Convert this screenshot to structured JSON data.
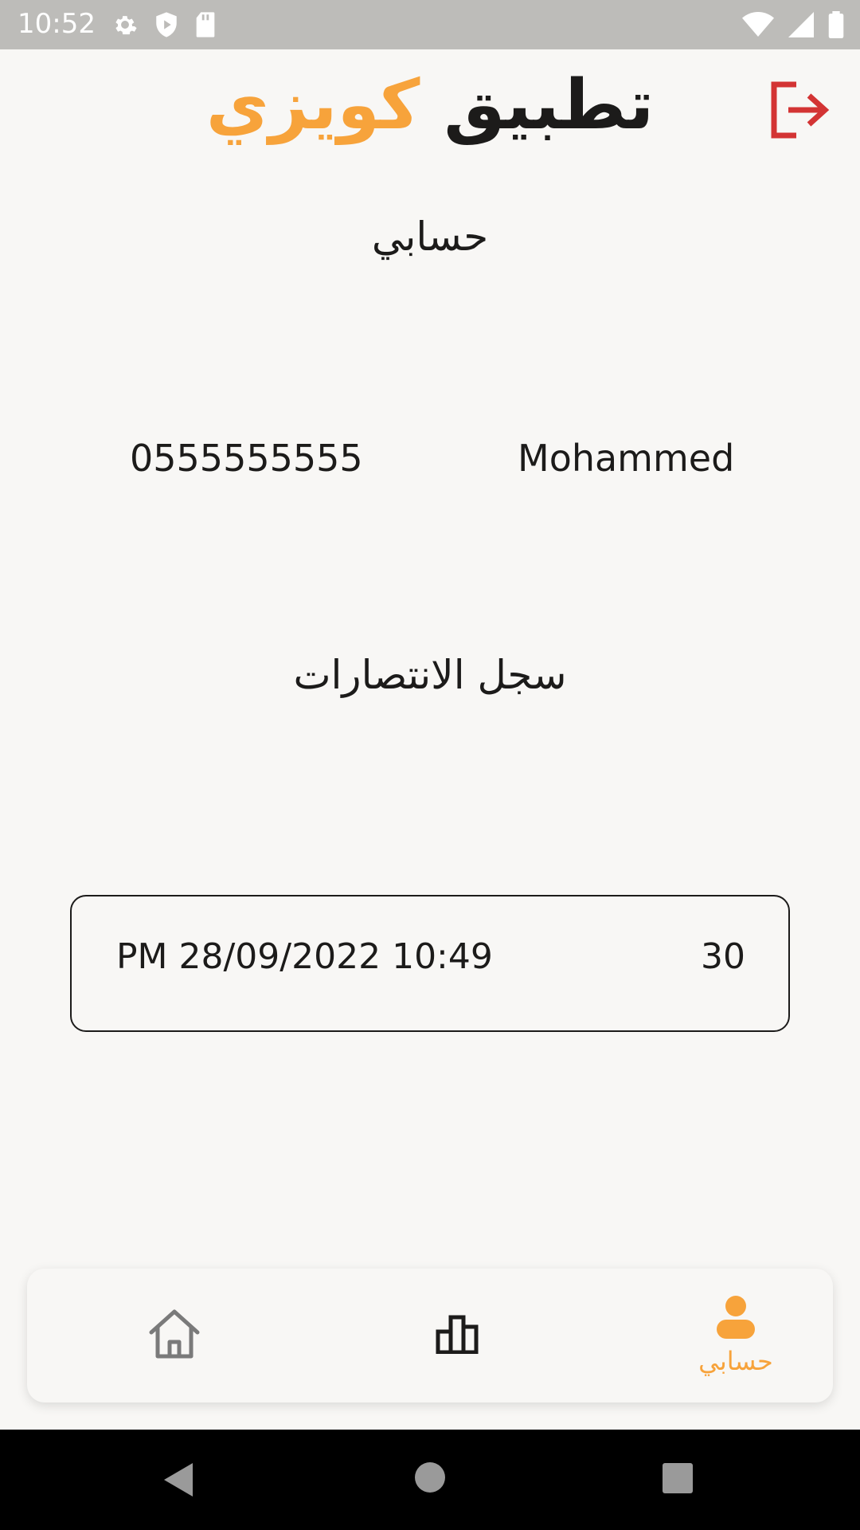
{
  "status_bar": {
    "time": "10:52",
    "icons_left": [
      "settings-icon",
      "shield-icon",
      "sd-card-icon"
    ],
    "icons_right": [
      "wifi-icon",
      "signal-icon",
      "battery-icon"
    ]
  },
  "header": {
    "title_part_1": "تطبيق",
    "title_part_2": "كويزي",
    "logout_icon": "logout-icon",
    "title_colors": {
      "primary": "#1c1b1a",
      "accent": "#f7a33b"
    },
    "logout_color": "#d33434"
  },
  "profile": {
    "section_title": "حسابي",
    "name": "Mohammed",
    "phone": "0555555555"
  },
  "wins": {
    "section_title": "سجل الانتصارات",
    "entries": [
      {
        "date": "PM 28/09/2022 10:49",
        "score": "30"
      }
    ]
  },
  "bottom_nav": {
    "items": [
      {
        "icon": "home-icon",
        "label": ""
      },
      {
        "icon": "leaderboard-icon",
        "label": ""
      },
      {
        "icon": "user-icon",
        "label": "حسابي",
        "active": true
      }
    ],
    "active_color": "#f7a33b",
    "inactive_color": "#7a7a7a"
  },
  "system_nav": {
    "icons": [
      "back-icon",
      "home-circle-icon",
      "recents-icon"
    ]
  }
}
